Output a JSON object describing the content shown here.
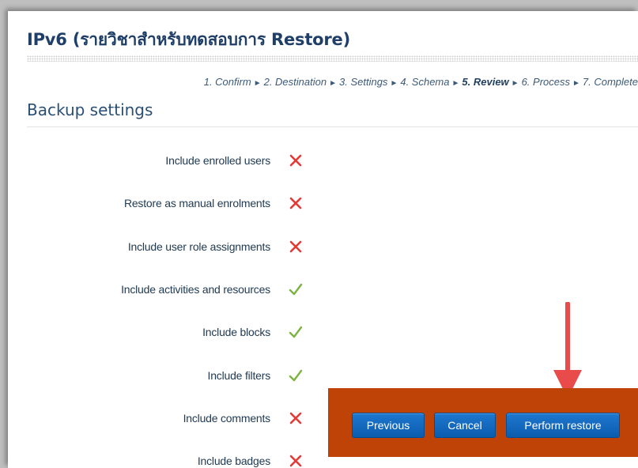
{
  "course_title": "IPv6 (รายวิชาสำหรับทดสอบการ Restore)",
  "breadcrumb": {
    "steps": [
      "1. Confirm",
      "2. Destination",
      "3. Settings",
      "4. Schema",
      "5. Review",
      "6. Process",
      "7. Complete"
    ],
    "current_step": "5. Review",
    "separator": "►"
  },
  "section_heading": "Backup settings",
  "settings": [
    {
      "label": "Include enrolled users",
      "state": "no",
      "icon": "cross-icon"
    },
    {
      "label": "Restore as manual enrolments",
      "state": "no",
      "icon": "cross-icon"
    },
    {
      "label": "Include user role assignments",
      "state": "no",
      "icon": "cross-icon"
    },
    {
      "label": "Include activities and resources",
      "state": "yes",
      "icon": "check-icon"
    },
    {
      "label": "Include blocks",
      "state": "yes",
      "icon": "check-icon"
    },
    {
      "label": "Include filters",
      "state": "yes",
      "icon": "check-icon"
    },
    {
      "label": "Include comments",
      "state": "no",
      "icon": "cross-icon"
    },
    {
      "label": "Include badges",
      "state": "no",
      "icon": "cross-icon"
    }
  ],
  "actions": {
    "previous_label": "Previous",
    "cancel_label": "Cancel",
    "perform_restore_label": "Perform restore"
  },
  "colors": {
    "cross": "#e53935",
    "check": "#7cb342",
    "action_bar": "#bf4206",
    "arrow": "#e94b4b",
    "button": "#0f67bf"
  }
}
